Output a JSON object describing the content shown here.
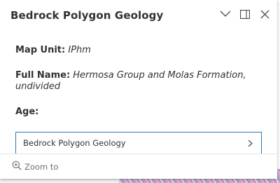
{
  "popup": {
    "title": "Bedrock Polygon Geology",
    "fields": [
      {
        "label": "Map Unit:",
        "value": "IPhm"
      },
      {
        "label": "Full Name:",
        "value": "Hermosa Group and Molas Formation, undivided"
      },
      {
        "label": "Age:",
        "value": ""
      }
    ],
    "related_record": {
      "label": "Bedrock Polygon Geology",
      "icon": "chevron-right-icon"
    },
    "actions": {
      "collapse_icon": "chevron-down-icon",
      "dock_icon": "dock-icon",
      "close_icon": "close-icon"
    },
    "footer": {
      "zoom_label": "Zoom to",
      "zoom_icon": "zoom-in-icon"
    }
  },
  "colors": {
    "accent": "#2a79b8",
    "text": "#323232",
    "muted": "#6e6e6e"
  }
}
